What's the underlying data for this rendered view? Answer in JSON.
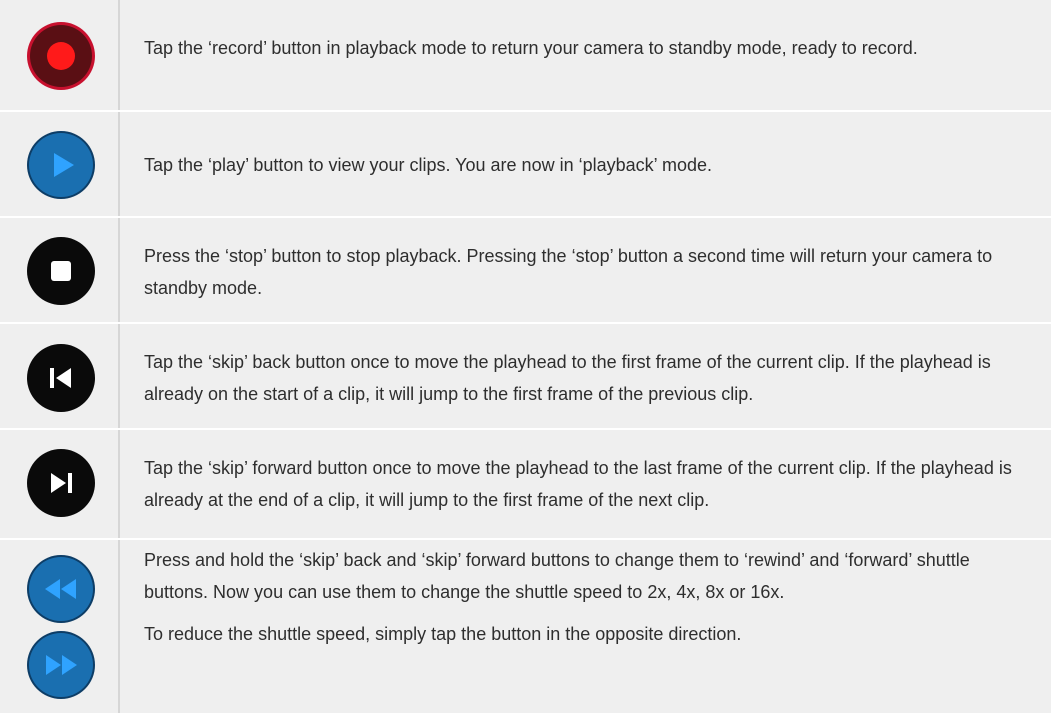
{
  "rows": [
    {
      "icon": "record-icon",
      "paragraphs": [
        "Tap the ‘record’ button in playback mode to return your camera to standby mode, ready to record."
      ]
    },
    {
      "icon": "play-icon",
      "paragraphs": [
        "Tap the ‘play’ button to view your clips. You are now in ‘playback’ mode."
      ]
    },
    {
      "icon": "stop-icon",
      "paragraphs": [
        "Press the ‘stop’ button to stop playback. Pressing the ‘stop’ button a second time will return your camera to standby mode."
      ]
    },
    {
      "icon": "skip-back-icon",
      "paragraphs": [
        "Tap the ‘skip’ back button once to move the playhead to the first frame of the current clip. If the playhead is already on the start of a clip, it will jump to the first frame of the previous clip."
      ]
    },
    {
      "icon": "skip-forward-icon",
      "paragraphs": [
        "Tap the ‘skip’ forward button once to move the playhead to the last frame of the current clip. If the playhead is already at the end of a clip, it will jump to the first frame of the next clip."
      ]
    },
    {
      "icons": [
        "rewind-icon",
        "fast-forward-icon"
      ],
      "paragraphs": [
        "Press and hold the ‘skip’ back and ‘skip’ forward buttons to change them to ‘rewind’ and ‘forward’ shuttle buttons. Now you can use them to change the shuttle speed to 2x, 4x, 8x or 16x.",
        "To reduce the shuttle speed, simply tap the button in the opposite direction."
      ]
    }
  ],
  "colors": {
    "row_background": "#efefef",
    "record_ring": "#c8102e",
    "record_fill": "#5a0f14",
    "record_dot": "#ff1a1a",
    "blue_button": "#1a6fb0",
    "blue_ring": "#0d3d66",
    "black_button": "#0a0a0a"
  }
}
